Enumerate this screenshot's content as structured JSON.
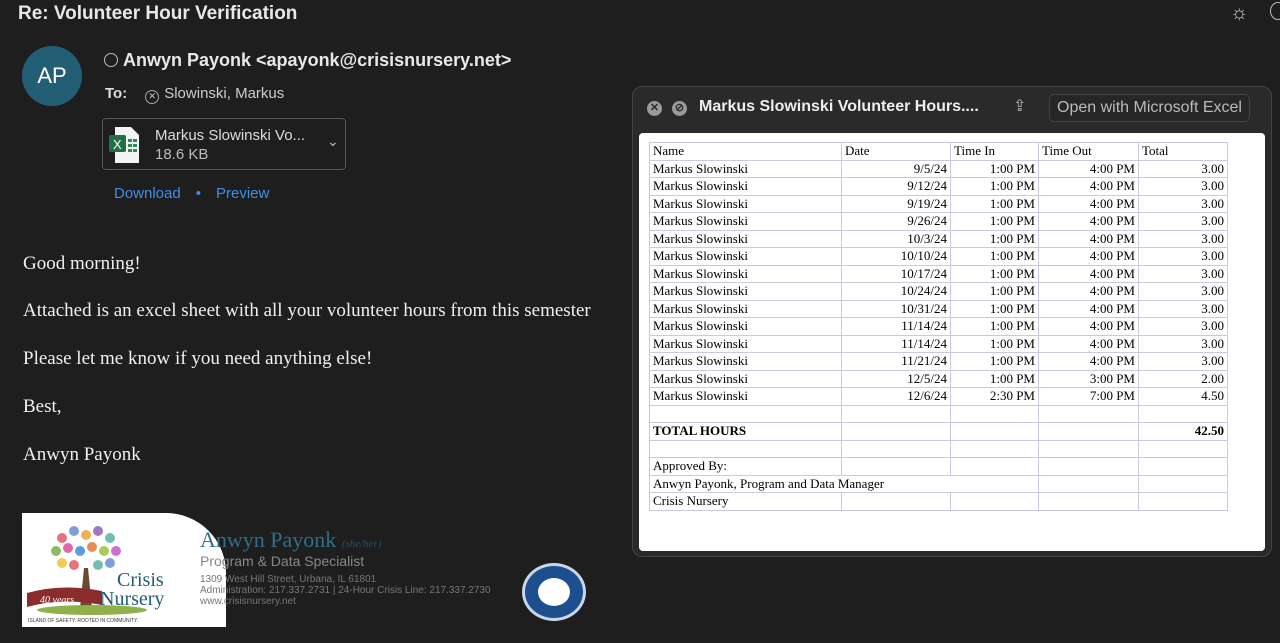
{
  "email": {
    "subject": "Re: Volunteer Hour Verification",
    "avatar_initials": "AP",
    "avatar_color": "#225e74",
    "from": "Anwyn Payonk <apayonk@crisisnursery.net>",
    "to_label": "To:",
    "to": "Slowinski, Markus",
    "attachment": {
      "name": "Markus Slowinski Vo...",
      "size": "18.6 KB",
      "icon": "excel-file-icon"
    },
    "download": "Download",
    "preview": "Preview",
    "body": [
      "Good morning!",
      "Attached is an excel sheet with all your volunteer hours from this semester",
      "Please let me know if you need anything else!",
      "Best,",
      "Anwyn Payonk"
    ],
    "signature": {
      "name": "Anwyn Payonk",
      "pronouns": "(she/her)",
      "title": "Program & Data Specialist",
      "address": "1309 West Hill Street, Urbana, IL 61801",
      "phones": "Administration: 217.337.2731 | 24-Hour Crisis Line: 217.337.2730",
      "web": "www.crisisnursery.net",
      "logo_text": "Crisis Nursery",
      "logo_years": "40 years",
      "logo_tagline": "ISLAND OF SAFETY. ROOTED IN COMMUNITY."
    }
  },
  "preview": {
    "title": "Markus Slowinski Volunteer Hours....",
    "open_button": "Open with Microsoft Excel",
    "headers": [
      "Name",
      "Date",
      "Time In",
      "Time Out",
      "Total"
    ],
    "rows": [
      [
        "Markus Slowinski",
        "9/5/24",
        "1:00 PM",
        "4:00 PM",
        "3.00"
      ],
      [
        "Markus Slowinski",
        "9/12/24",
        "1:00 PM",
        "4:00 PM",
        "3.00"
      ],
      [
        "Markus Slowinski",
        "9/19/24",
        "1:00 PM",
        "4:00 PM",
        "3.00"
      ],
      [
        "Markus Slowinski",
        "9/26/24",
        "1:00 PM",
        "4:00 PM",
        "3.00"
      ],
      [
        "Markus Slowinski",
        "10/3/24",
        "1:00 PM",
        "4:00 PM",
        "3.00"
      ],
      [
        "Markus Slowinski",
        "10/10/24",
        "1:00 PM",
        "4:00 PM",
        "3.00"
      ],
      [
        "Markus Slowinski",
        "10/17/24",
        "1:00 PM",
        "4:00 PM",
        "3.00"
      ],
      [
        "Markus Slowinski",
        "10/24/24",
        "1:00 PM",
        "4:00 PM",
        "3.00"
      ],
      [
        "Markus Slowinski",
        "10/31/24",
        "1:00 PM",
        "4:00 PM",
        "3.00"
      ],
      [
        "Markus Slowinski",
        "11/14/24",
        "1:00 PM",
        "4:00 PM",
        "3.00"
      ],
      [
        "Markus Slowinski",
        "11/14/24",
        "1:00 PM",
        "4:00 PM",
        "3.00"
      ],
      [
        "Markus Slowinski",
        "11/21/24",
        "1:00 PM",
        "4:00 PM",
        "3.00"
      ],
      [
        "Markus Slowinski",
        "12/5/24",
        "1:00 PM",
        "3:00 PM",
        "2.00"
      ],
      [
        "Markus Slowinski",
        "12/6/24",
        "2:30 PM",
        "7:00 PM",
        "4.50"
      ]
    ],
    "total_label": "TOTAL HOURS",
    "total": "42.50",
    "approved_by": "Approved By:",
    "approver": "Anwyn Payonk, Program and Data Manager",
    "org": "Crisis Nursery"
  }
}
